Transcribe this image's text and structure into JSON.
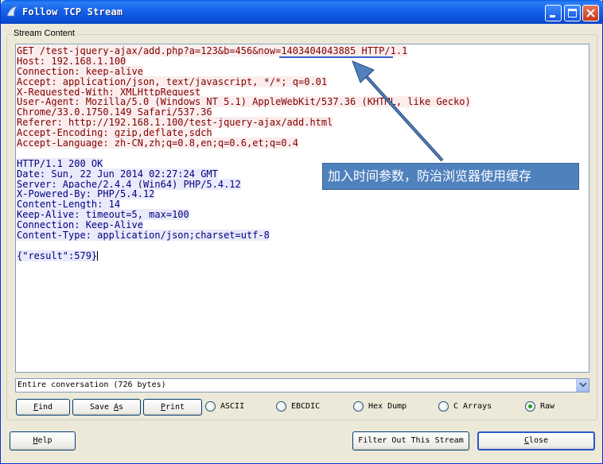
{
  "window": {
    "title": "Follow TCP Stream"
  },
  "group_label": "Stream Content",
  "stream": {
    "request_lines": [
      "GET /test-jquery-ajax/add.php?a=123&b=456&now=1403404043885 HTTP/1.1",
      "Host: 192.168.1.100",
      "Connection: keep-alive",
      "Accept: application/json, text/javascript, */*; q=0.01",
      "X-Requested-With: XMLHttpRequest",
      "User-Agent: Mozilla/5.0 (Windows NT 5.1) AppleWebKit/537.36 (KHTML, like Gecko)",
      "Chrome/33.0.1750.149 Safari/537.36",
      "Referer: http://192.168.1.100/test-jquery-ajax/add.html",
      "Accept-Encoding: gzip,deflate,sdch",
      "Accept-Language: zh-CN,zh;q=0.8,en;q=0.6,et;q=0.4"
    ],
    "response_lines": [
      "HTTP/1.1 200 OK",
      "Date: Sun, 22 Jun 2014 02:27:24 GMT",
      "Server: Apache/2.4.4 (Win64) PHP/5.4.12",
      "X-Powered-By: PHP/5.4.12",
      "Content-Length: 14",
      "Keep-Alive: timeout=5, max=100",
      "Connection: Keep-Alive",
      "Content-Type: application/json;charset=utf-8"
    ],
    "response_body": "{\"result\":579}"
  },
  "annotation": {
    "text": "加入时间参数，防治浏览器使用缓存"
  },
  "conversation_select": {
    "value": "Entire conversation (726 bytes)"
  },
  "buttons": {
    "find": {
      "pre": "",
      "u": "F",
      "post": "ind"
    },
    "save_as": {
      "pre": "Save ",
      "u": "A",
      "post": "s"
    },
    "print": {
      "pre": "",
      "u": "P",
      "post": "rint"
    },
    "help": {
      "pre": "",
      "u": "H",
      "post": "elp"
    },
    "filter_out": "Filter Out This Stream",
    "close": {
      "pre": "",
      "u": "C",
      "post": "lose"
    }
  },
  "formats": [
    {
      "label": "ASCII",
      "selected": false
    },
    {
      "label": "EBCDIC",
      "selected": false
    },
    {
      "label": "Hex Dump",
      "selected": false
    },
    {
      "label": "C Arrays",
      "selected": false
    },
    {
      "label": "Raw",
      "selected": true
    }
  ],
  "colors": {
    "request_text": "#800000",
    "response_text": "#000080",
    "annotation_bg": "#4f81bd"
  }
}
